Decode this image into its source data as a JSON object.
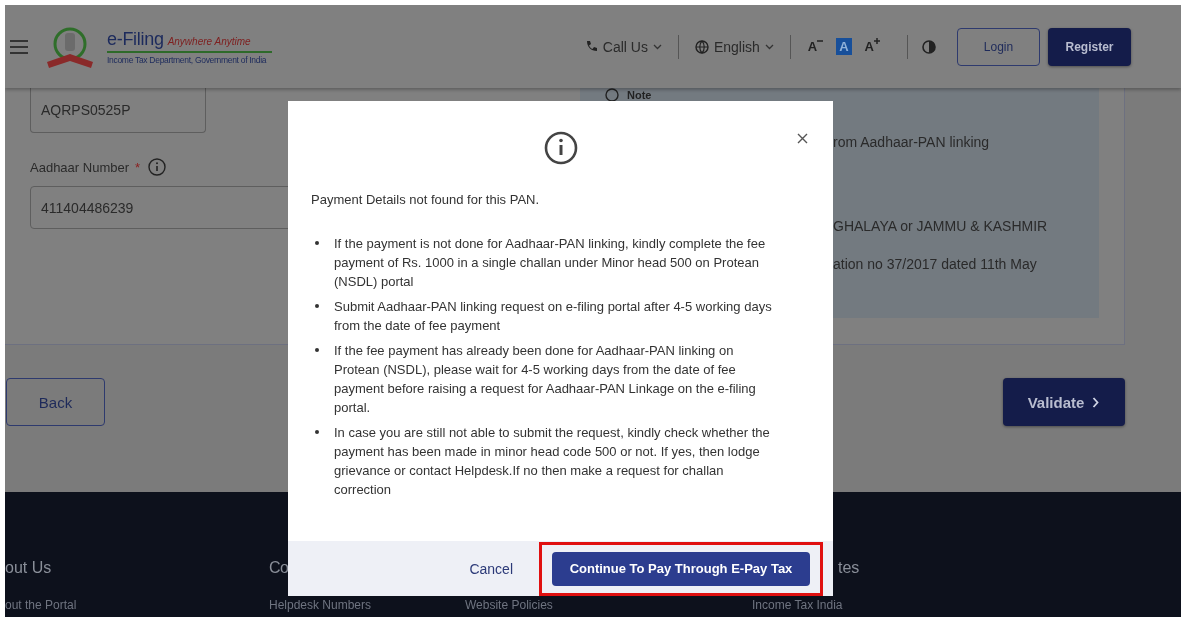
{
  "header": {
    "logo": {
      "title": "e-Filing",
      "tagline": "Anywhere Anytime",
      "department": "Income Tax Department, Government of India"
    },
    "call_us": "Call Us",
    "language": "English",
    "font_controls": [
      {
        "label": "A",
        "kind": "decrease",
        "selected": false
      },
      {
        "label": "A",
        "kind": "normal",
        "selected": true
      },
      {
        "label": "A",
        "kind": "increase",
        "selected": false
      }
    ],
    "login": "Login",
    "register": "Register"
  },
  "form": {
    "pan_value": "AQRPS0525P",
    "aadhaar_label": "Aadhaar Number",
    "required_mark": "*",
    "aadhaar_value": "411404486239"
  },
  "note": {
    "title": "Note",
    "lines": [
      "rom Aadhaar-PAN linking",
      "GHALAYA or JAMMU & KASHMIR",
      "ation no 37/2017 dated 11th May"
    ]
  },
  "actions": {
    "back": "Back",
    "validate": "Validate"
  },
  "footer": {
    "columns": [
      {
        "heading": "out Us",
        "link": "out the Portal"
      },
      {
        "heading": "Co",
        "link": "Helpdesk Numbers"
      },
      {
        "link": "Website Policies"
      },
      {
        "heading": "tes",
        "link": "Income Tax India"
      }
    ]
  },
  "modal": {
    "message": "Payment Details not found for this PAN.",
    "bullets": [
      "If the payment is not done for Aadhaar-PAN linking, kindly complete the fee payment of Rs. 1000 in a single challan under Minor head 500 on Protean (NSDL) portal",
      "Submit Aadhaar-PAN linking request on e-filing portal after 4-5 working days from the date of fee payment",
      "If the fee payment has already been done for Aadhaar-PAN linking on Protean (NSDL), please wait for 4-5 working days from the date of fee payment before raising a request for Aadhaar-PAN Linkage on the e-filing portal.",
      "In case you are still not able to submit the request, kindly check whether the payment has been made in minor head code 500 or not. If yes, then lodge grievance or contact Helpdesk.If no then make a request for challan correction"
    ],
    "cancel": "Cancel",
    "continue": "Continue To Pay Through E-Pay Tax",
    "continue_highlighted": true
  }
}
